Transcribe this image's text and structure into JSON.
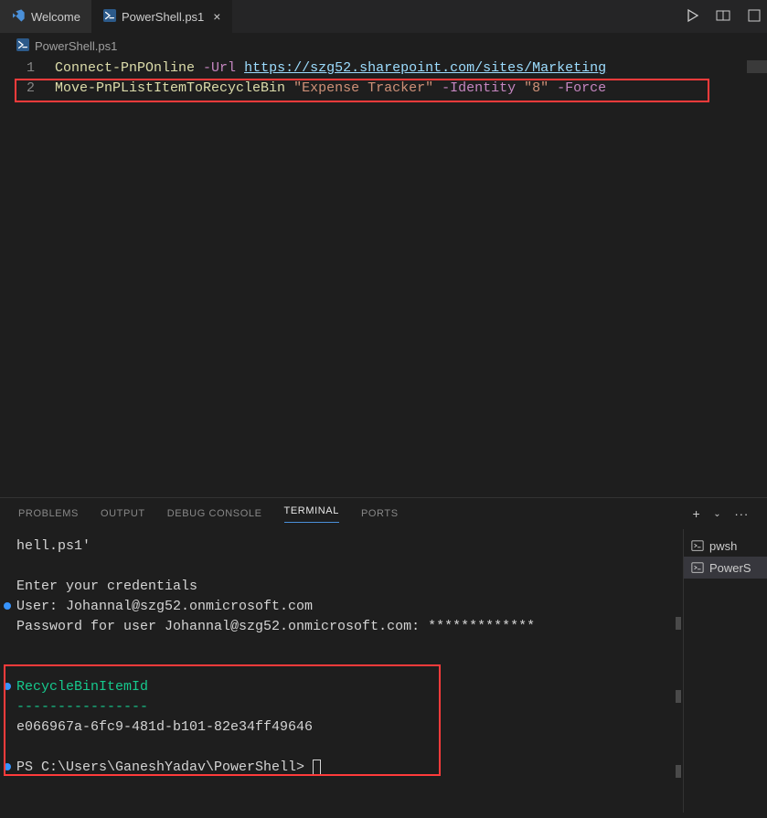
{
  "tabs": {
    "welcome": "Welcome",
    "active": "PowerShell.ps1"
  },
  "breadcrumb": "PowerShell.ps1",
  "editor": {
    "lines": [
      {
        "num": "1",
        "cmd": "Connect-PnPOnline",
        "param1": "-Url",
        "url": "https://szg52.sharepoint.com/sites/Marketing"
      },
      {
        "num": "2",
        "cmd": "Move-PnPListItemToRecycleBin",
        "str1": "\"Expense Tracker\"",
        "param2": "-Identity",
        "str2": "\"8\"",
        "param3": "-Force"
      }
    ]
  },
  "panel": {
    "problems": "PROBLEMS",
    "output": "OUTPUT",
    "debug": "DEBUG CONSOLE",
    "terminal": "TERMINAL",
    "ports": "PORTS"
  },
  "terminal": {
    "l1": "hell.ps1'",
    "l2": "Enter your credentials",
    "l3": "User: Johannal@szg52.onmicrosoft.com",
    "l4": "Password for user Johannal@szg52.onmicrosoft.com: *************",
    "l5": "RecycleBinItemId",
    "l6": "----------------",
    "l7": "e066967a-6fc9-481d-b101-82e34ff49646",
    "prompt": "PS C:\\Users\\GaneshYadav\\PowerShell> "
  },
  "sessions": {
    "s1": "pwsh",
    "s2": "PowerS"
  }
}
